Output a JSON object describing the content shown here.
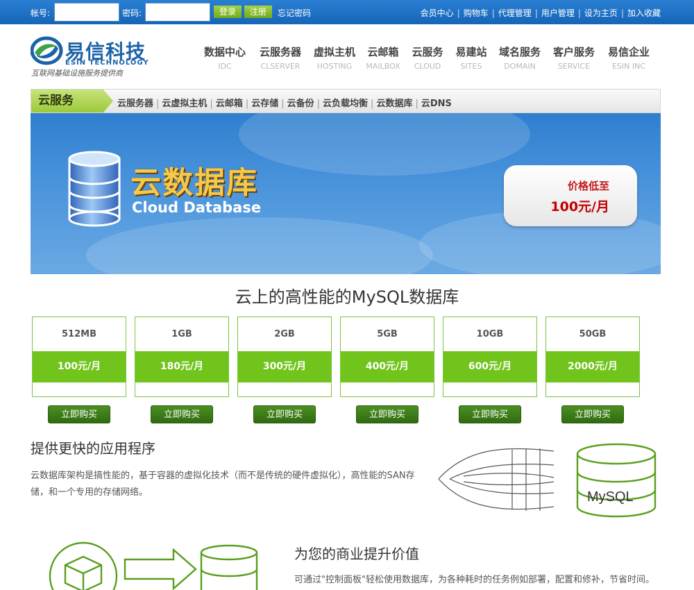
{
  "topbar": {
    "account_label": "帐号:",
    "password_label": "密码:",
    "login_button": "登录",
    "register_button": "注册",
    "forgot_link": "忘记密码",
    "links": [
      "会员中心",
      "购物车",
      "代理管理",
      "用户管理",
      "设为主页",
      "加入收藏"
    ]
  },
  "logo": {
    "cn": "易信科技",
    "en": "ESIN TECHNOLOGY",
    "slogan": "互联网基础设施服务提供商"
  },
  "nav": [
    {
      "cn": "数据中心",
      "en": "IDC"
    },
    {
      "cn": "云服务器",
      "en": "CLSERVER"
    },
    {
      "cn": "虚拟主机",
      "en": "HOSTING"
    },
    {
      "cn": "云邮箱",
      "en": "MAILBOX"
    },
    {
      "cn": "云服务",
      "en": "CLOUD"
    },
    {
      "cn": "易建站",
      "en": "SITES"
    },
    {
      "cn": "域名服务",
      "en": "DOMAIN"
    },
    {
      "cn": "客户服务",
      "en": "SERVICE"
    },
    {
      "cn": "易信企业",
      "en": "ESIN INC"
    }
  ],
  "subnav": {
    "tag": "云服务",
    "links": [
      "云服务器",
      "云虚拟主机",
      "云邮箱",
      "云存储",
      "云备份",
      "云负载均衡",
      "云数据库",
      "云DNS"
    ]
  },
  "banner": {
    "title_cn": "云数据库",
    "title_en": "Cloud Database",
    "price_line1": "价格低至",
    "price_line2": "100元/月"
  },
  "pricing": {
    "title": "云上的高性能的MySQL数据库",
    "buy_label": "立即购买",
    "plans": [
      {
        "size": "512MB",
        "price": "100元/月"
      },
      {
        "size": "1GB",
        "price": "180元/月"
      },
      {
        "size": "2GB",
        "price": "300元/月"
      },
      {
        "size": "5GB",
        "price": "400元/月"
      },
      {
        "size": "10GB",
        "price": "600元/月"
      },
      {
        "size": "50GB",
        "price": "2000元/月"
      }
    ]
  },
  "feature1": {
    "heading": "提供更快的应用程序",
    "text": "云数据库架构是搞性能的，基于容器的虚拟化技术（而不是传统的硬件虚拟化），高性能的SAN存储，和一个专用的存储网络。",
    "art_label": "MySQL"
  },
  "feature2": {
    "heading": "为您的商业提升价值",
    "text": "可通过\"控制面板\"轻松使用数据库，为各种耗时的任务例如部署，配置和修补，节省时间。"
  },
  "colors": {
    "topbar": "#1a6ec3",
    "accent_green": "#70c41b",
    "buy_green": "#3b7a18",
    "logo_blue": "#1c62a8",
    "price_red": "#c20000"
  }
}
